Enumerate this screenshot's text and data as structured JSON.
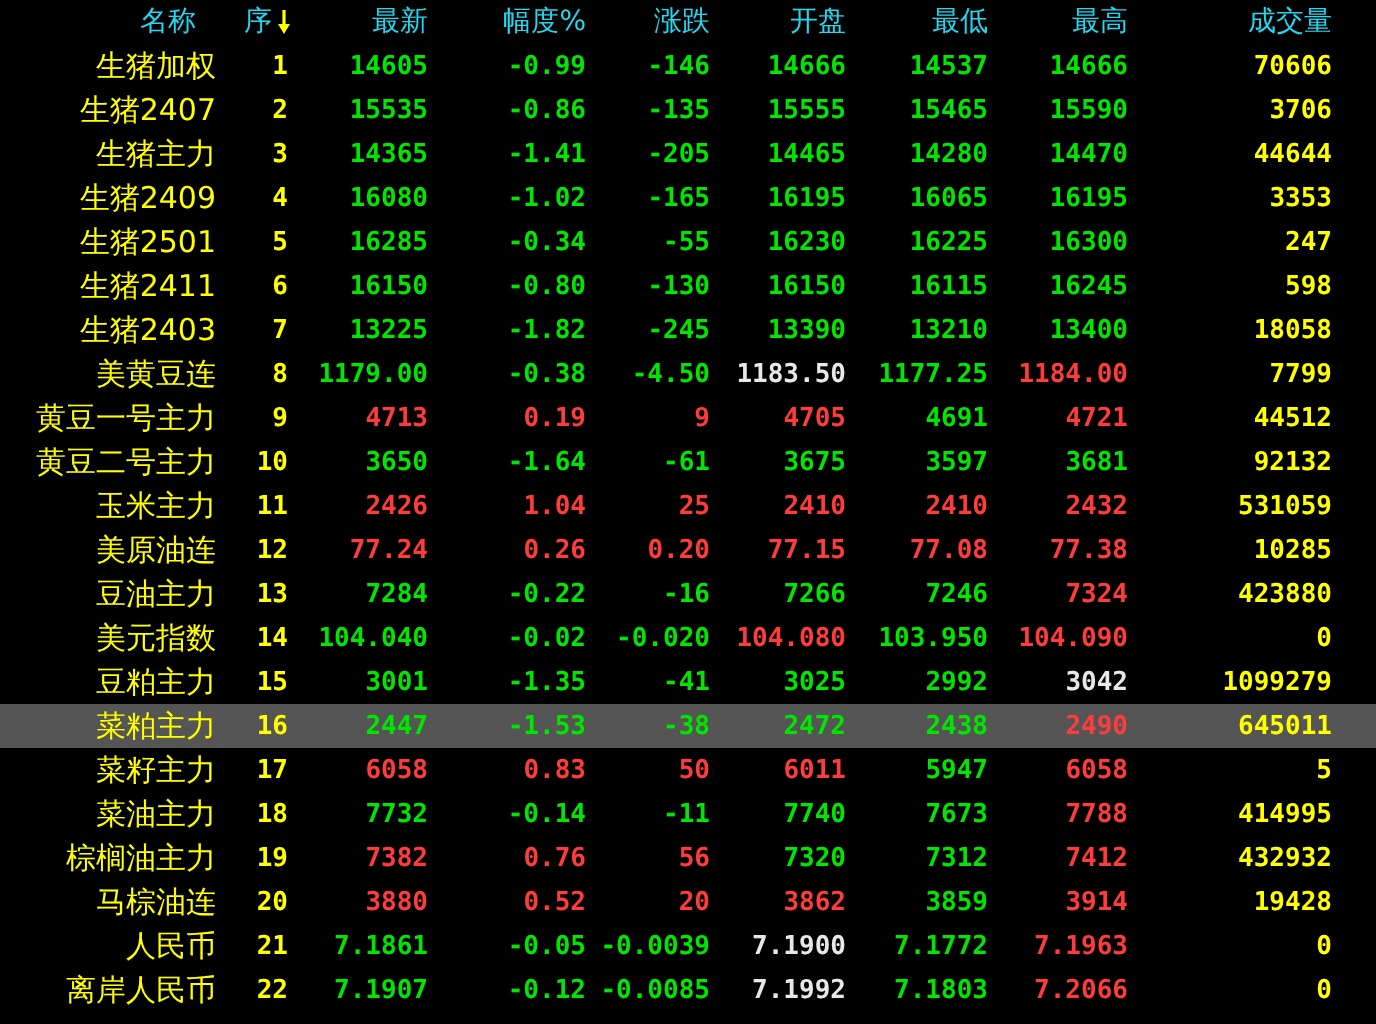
{
  "columns": [
    {
      "label": "名称",
      "sorted": false
    },
    {
      "label": "序",
      "sorted": true
    },
    {
      "label": "最新",
      "sorted": false
    },
    {
      "label": "幅度%",
      "sorted": false
    },
    {
      "label": "涨跌",
      "sorted": false
    },
    {
      "label": "开盘",
      "sorted": false
    },
    {
      "label": "最低",
      "sorted": false
    },
    {
      "label": "最高",
      "sorted": false
    },
    {
      "label": "成交量",
      "sorted": false
    }
  ],
  "rows": [
    {
      "name": "生猪加权",
      "seq": "1",
      "selected": false,
      "cells": [
        {
          "text": "14605",
          "color": "#00e600"
        },
        {
          "text": "-0.99",
          "color": "#00e600"
        },
        {
          "text": "-146",
          "color": "#00e600"
        },
        {
          "text": "14666",
          "color": "#00e600"
        },
        {
          "text": "14537",
          "color": "#00e600"
        },
        {
          "text": "14666",
          "color": "#00e600"
        }
      ],
      "volume": "70606"
    },
    {
      "name": "生猪2407",
      "seq": "2",
      "selected": false,
      "cells": [
        {
          "text": "15535",
          "color": "#00e600"
        },
        {
          "text": "-0.86",
          "color": "#00e600"
        },
        {
          "text": "-135",
          "color": "#00e600"
        },
        {
          "text": "15555",
          "color": "#00e600"
        },
        {
          "text": "15465",
          "color": "#00e600"
        },
        {
          "text": "15590",
          "color": "#00e600"
        }
      ],
      "volume": "3706"
    },
    {
      "name": "生猪主力",
      "seq": "3",
      "selected": false,
      "cells": [
        {
          "text": "14365",
          "color": "#00e600"
        },
        {
          "text": "-1.41",
          "color": "#00e600"
        },
        {
          "text": "-205",
          "color": "#00e600"
        },
        {
          "text": "14465",
          "color": "#00e600"
        },
        {
          "text": "14280",
          "color": "#00e600"
        },
        {
          "text": "14470",
          "color": "#00e600"
        }
      ],
      "volume": "44644"
    },
    {
      "name": "生猪2409",
      "seq": "4",
      "selected": false,
      "cells": [
        {
          "text": "16080",
          "color": "#00e600"
        },
        {
          "text": "-1.02",
          "color": "#00e600"
        },
        {
          "text": "-165",
          "color": "#00e600"
        },
        {
          "text": "16195",
          "color": "#00e600"
        },
        {
          "text": "16065",
          "color": "#00e600"
        },
        {
          "text": "16195",
          "color": "#00e600"
        }
      ],
      "volume": "3353"
    },
    {
      "name": "生猪2501",
      "seq": "5",
      "selected": false,
      "cells": [
        {
          "text": "16285",
          "color": "#00e600"
        },
        {
          "text": "-0.34",
          "color": "#00e600"
        },
        {
          "text": "-55",
          "color": "#00e600"
        },
        {
          "text": "16230",
          "color": "#00e600"
        },
        {
          "text": "16225",
          "color": "#00e600"
        },
        {
          "text": "16300",
          "color": "#00e600"
        }
      ],
      "volume": "247"
    },
    {
      "name": "生猪2411",
      "seq": "6",
      "selected": false,
      "cells": [
        {
          "text": "16150",
          "color": "#00e600"
        },
        {
          "text": "-0.80",
          "color": "#00e600"
        },
        {
          "text": "-130",
          "color": "#00e600"
        },
        {
          "text": "16150",
          "color": "#00e600"
        },
        {
          "text": "16115",
          "color": "#00e600"
        },
        {
          "text": "16245",
          "color": "#00e600"
        }
      ],
      "volume": "598"
    },
    {
      "name": "生猪2403",
      "seq": "7",
      "selected": false,
      "cells": [
        {
          "text": "13225",
          "color": "#00e600"
        },
        {
          "text": "-1.82",
          "color": "#00e600"
        },
        {
          "text": "-245",
          "color": "#00e600"
        },
        {
          "text": "13390",
          "color": "#00e600"
        },
        {
          "text": "13210",
          "color": "#00e600"
        },
        {
          "text": "13400",
          "color": "#00e600"
        }
      ],
      "volume": "18058"
    },
    {
      "name": "美黄豆连",
      "seq": "8",
      "selected": false,
      "cells": [
        {
          "text": "1179.00",
          "color": "#00e600"
        },
        {
          "text": "-0.38",
          "color": "#00e600"
        },
        {
          "text": "-4.50",
          "color": "#00e600"
        },
        {
          "text": "1183.50",
          "color": "#e8e8e8"
        },
        {
          "text": "1177.25",
          "color": "#00e600"
        },
        {
          "text": "1184.00",
          "color": "#ff3c3c"
        }
      ],
      "volume": "7799"
    },
    {
      "name": "黄豆一号主力",
      "seq": "9",
      "selected": false,
      "cells": [
        {
          "text": "4713",
          "color": "#ff3c3c"
        },
        {
          "text": "0.19",
          "color": "#ff3c3c"
        },
        {
          "text": "9",
          "color": "#ff3c3c"
        },
        {
          "text": "4705",
          "color": "#ff3c3c"
        },
        {
          "text": "4691",
          "color": "#00e600"
        },
        {
          "text": "4721",
          "color": "#ff3c3c"
        }
      ],
      "volume": "44512"
    },
    {
      "name": "黄豆二号主力",
      "seq": "10",
      "selected": false,
      "cells": [
        {
          "text": "3650",
          "color": "#00e600"
        },
        {
          "text": "-1.64",
          "color": "#00e600"
        },
        {
          "text": "-61",
          "color": "#00e600"
        },
        {
          "text": "3675",
          "color": "#00e600"
        },
        {
          "text": "3597",
          "color": "#00e600"
        },
        {
          "text": "3681",
          "color": "#00e600"
        }
      ],
      "volume": "92132"
    },
    {
      "name": "玉米主力",
      "seq": "11",
      "selected": false,
      "cells": [
        {
          "text": "2426",
          "color": "#ff3c3c"
        },
        {
          "text": "1.04",
          "color": "#ff3c3c"
        },
        {
          "text": "25",
          "color": "#ff3c3c"
        },
        {
          "text": "2410",
          "color": "#ff3c3c"
        },
        {
          "text": "2410",
          "color": "#ff3c3c"
        },
        {
          "text": "2432",
          "color": "#ff3c3c"
        }
      ],
      "volume": "531059"
    },
    {
      "name": "美原油连",
      "seq": "12",
      "selected": false,
      "cells": [
        {
          "text": "77.24",
          "color": "#ff3c3c"
        },
        {
          "text": "0.26",
          "color": "#ff3c3c"
        },
        {
          "text": "0.20",
          "color": "#ff3c3c"
        },
        {
          "text": "77.15",
          "color": "#ff3c3c"
        },
        {
          "text": "77.08",
          "color": "#ff3c3c"
        },
        {
          "text": "77.38",
          "color": "#ff3c3c"
        }
      ],
      "volume": "10285"
    },
    {
      "name": "豆油主力",
      "seq": "13",
      "selected": false,
      "cells": [
        {
          "text": "7284",
          "color": "#00e600"
        },
        {
          "text": "-0.22",
          "color": "#00e600"
        },
        {
          "text": "-16",
          "color": "#00e600"
        },
        {
          "text": "7266",
          "color": "#00e600"
        },
        {
          "text": "7246",
          "color": "#00e600"
        },
        {
          "text": "7324",
          "color": "#ff3c3c"
        }
      ],
      "volume": "423880"
    },
    {
      "name": "美元指数",
      "seq": "14",
      "selected": false,
      "cells": [
        {
          "text": "104.040",
          "color": "#00e600"
        },
        {
          "text": "-0.02",
          "color": "#00e600"
        },
        {
          "text": "-0.020",
          "color": "#00e600"
        },
        {
          "text": "104.080",
          "color": "#ff3c3c"
        },
        {
          "text": "103.950",
          "color": "#00e600"
        },
        {
          "text": "104.090",
          "color": "#ff3c3c"
        }
      ],
      "volume": "0"
    },
    {
      "name": "豆粕主力",
      "seq": "15",
      "selected": false,
      "cells": [
        {
          "text": "3001",
          "color": "#00e600"
        },
        {
          "text": "-1.35",
          "color": "#00e600"
        },
        {
          "text": "-41",
          "color": "#00e600"
        },
        {
          "text": "3025",
          "color": "#00e600"
        },
        {
          "text": "2992",
          "color": "#00e600"
        },
        {
          "text": "3042",
          "color": "#e8e8e8"
        }
      ],
      "volume": "1099279"
    },
    {
      "name": "菜粕主力",
      "seq": "16",
      "selected": true,
      "cells": [
        {
          "text": "2447",
          "color": "#00e600"
        },
        {
          "text": "-1.53",
          "color": "#00e600"
        },
        {
          "text": "-38",
          "color": "#00e600"
        },
        {
          "text": "2472",
          "color": "#00e600"
        },
        {
          "text": "2438",
          "color": "#00e600"
        },
        {
          "text": "2490",
          "color": "#ff3c3c"
        }
      ],
      "volume": "645011"
    },
    {
      "name": "菜籽主力",
      "seq": "17",
      "selected": false,
      "cells": [
        {
          "text": "6058",
          "color": "#ff3c3c"
        },
        {
          "text": "0.83",
          "color": "#ff3c3c"
        },
        {
          "text": "50",
          "color": "#ff3c3c"
        },
        {
          "text": "6011",
          "color": "#ff3c3c"
        },
        {
          "text": "5947",
          "color": "#00e600"
        },
        {
          "text": "6058",
          "color": "#ff3c3c"
        }
      ],
      "volume": "5"
    },
    {
      "name": "菜油主力",
      "seq": "18",
      "selected": false,
      "cells": [
        {
          "text": "7732",
          "color": "#00e600"
        },
        {
          "text": "-0.14",
          "color": "#00e600"
        },
        {
          "text": "-11",
          "color": "#00e600"
        },
        {
          "text": "7740",
          "color": "#00e600"
        },
        {
          "text": "7673",
          "color": "#00e600"
        },
        {
          "text": "7788",
          "color": "#ff3c3c"
        }
      ],
      "volume": "414995"
    },
    {
      "name": "棕榈油主力",
      "seq": "19",
      "selected": false,
      "cells": [
        {
          "text": "7382",
          "color": "#ff3c3c"
        },
        {
          "text": "0.76",
          "color": "#ff3c3c"
        },
        {
          "text": "56",
          "color": "#ff3c3c"
        },
        {
          "text": "7320",
          "color": "#00e600"
        },
        {
          "text": "7312",
          "color": "#00e600"
        },
        {
          "text": "7412",
          "color": "#ff3c3c"
        }
      ],
      "volume": "432932"
    },
    {
      "name": "马棕油连",
      "seq": "20",
      "selected": false,
      "cells": [
        {
          "text": "3880",
          "color": "#ff3c3c"
        },
        {
          "text": "0.52",
          "color": "#ff3c3c"
        },
        {
          "text": "20",
          "color": "#ff3c3c"
        },
        {
          "text": "3862",
          "color": "#ff3c3c"
        },
        {
          "text": "3859",
          "color": "#00e600"
        },
        {
          "text": "3914",
          "color": "#ff3c3c"
        }
      ],
      "volume": "19428"
    },
    {
      "name": "人民币",
      "seq": "21",
      "selected": false,
      "cells": [
        {
          "text": "7.1861",
          "color": "#00e600"
        },
        {
          "text": "-0.05",
          "color": "#00e600"
        },
        {
          "text": "-0.0039",
          "color": "#00e600"
        },
        {
          "text": "7.1900",
          "color": "#e8e8e8"
        },
        {
          "text": "7.1772",
          "color": "#00e600"
        },
        {
          "text": "7.1963",
          "color": "#ff3c3c"
        }
      ],
      "volume": "0"
    },
    {
      "name": "离岸人民币",
      "seq": "22",
      "selected": false,
      "cells": [
        {
          "text": "7.1907",
          "color": "#00e600"
        },
        {
          "text": "-0.12",
          "color": "#00e600"
        },
        {
          "text": "-0.0085",
          "color": "#00e600"
        },
        {
          "text": "7.1992",
          "color": "#e8e8e8"
        },
        {
          "text": "7.1803",
          "color": "#00e600"
        },
        {
          "text": "7.2066",
          "color": "#ff3c3c"
        }
      ],
      "volume": "0"
    }
  ]
}
